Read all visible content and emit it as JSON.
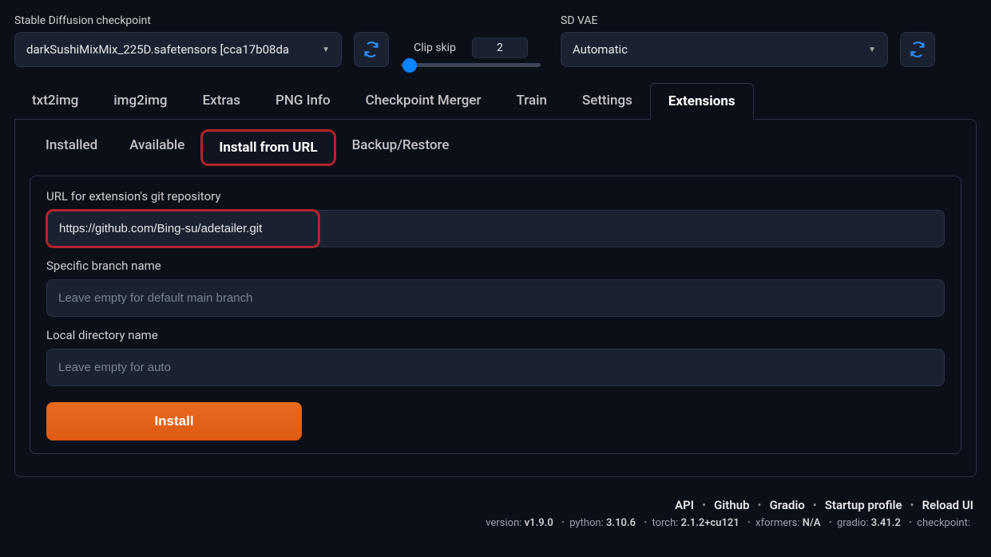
{
  "top": {
    "checkpoint_label": "Stable Diffusion checkpoint",
    "checkpoint_value": "darkSushiMixMix_225D.safetensors [cca17b08da",
    "clipskip_label": "Clip skip",
    "clipskip_value": "2",
    "vae_label": "SD VAE",
    "vae_value": "Automatic"
  },
  "main_tabs": [
    "txt2img",
    "img2img",
    "Extras",
    "PNG Info",
    "Checkpoint Merger",
    "Train",
    "Settings",
    "Extensions"
  ],
  "main_tab_active": "Extensions",
  "sub_tabs": [
    "Installed",
    "Available",
    "Install from URL",
    "Backup/Restore"
  ],
  "sub_tab_active": "Install from URL",
  "form": {
    "url_label": "URL for extension's git repository",
    "url_value": "https://github.com/Bing-su/adetailer.git",
    "branch_label": "Specific branch name",
    "branch_placeholder": "Leave empty for default main branch",
    "dir_label": "Local directory name",
    "dir_placeholder": "Leave empty for auto",
    "install_label": "Install"
  },
  "footer": {
    "links": [
      "API",
      "Github",
      "Gradio",
      "Startup profile",
      "Reload UI"
    ],
    "version_items": [
      {
        "k": "version",
        "v": "v1.9.0"
      },
      {
        "k": "python",
        "v": "3.10.6"
      },
      {
        "k": "torch",
        "v": "2.1.2+cu121"
      },
      {
        "k": "xformers",
        "v": "N/A"
      },
      {
        "k": "gradio",
        "v": "3.41.2"
      },
      {
        "k": "checkpoint",
        "v": ""
      }
    ]
  }
}
